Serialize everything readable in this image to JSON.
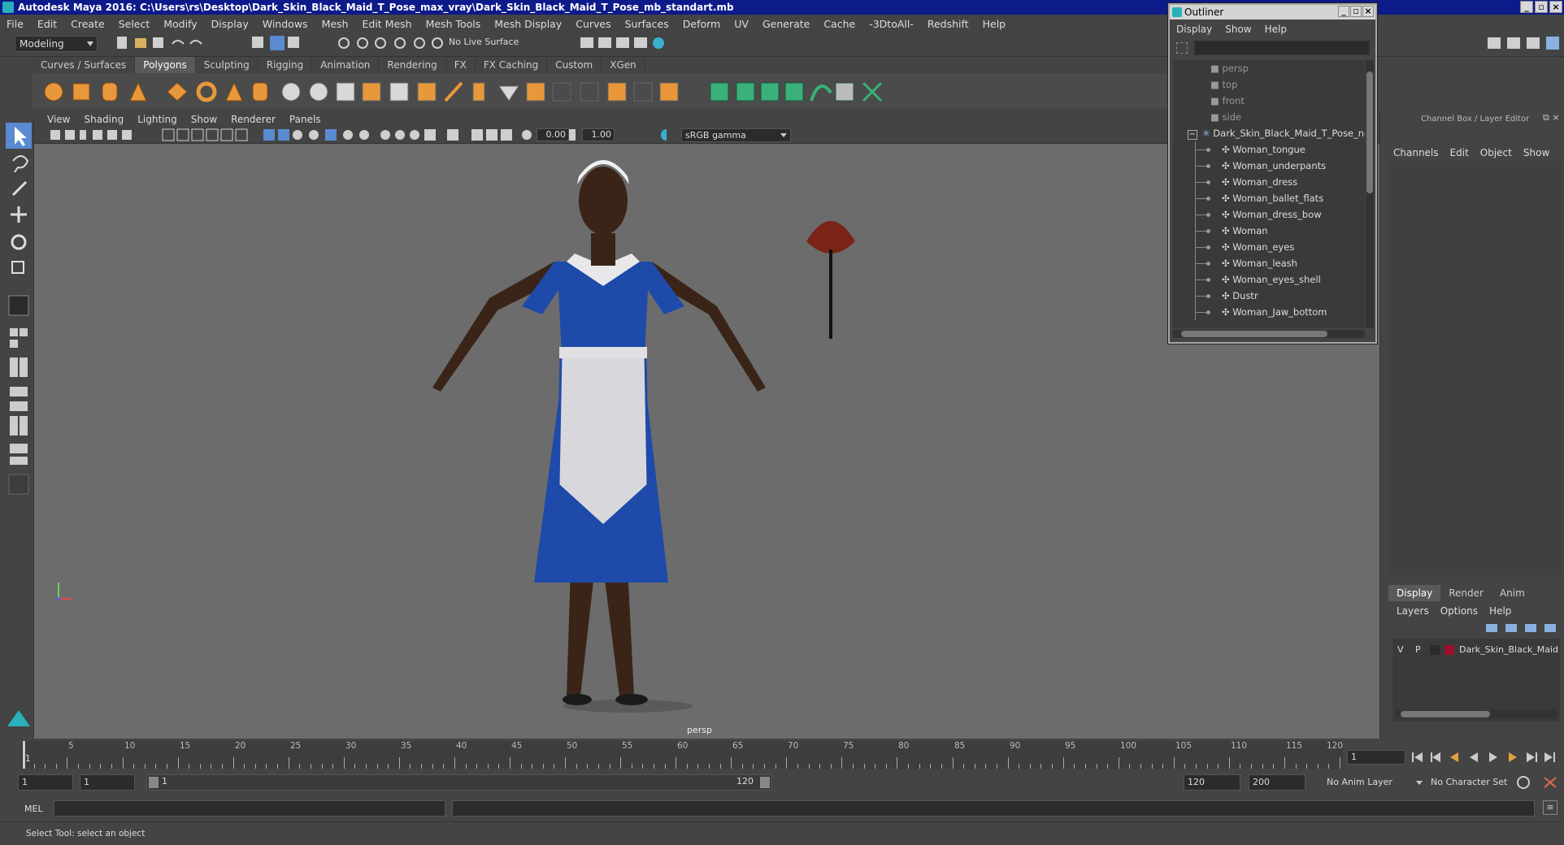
{
  "window": {
    "title": "Autodesk Maya 2016: C:\\Users\\rs\\Desktop\\Dark_Skin_Black_Maid_T_Pose_max_vray\\Dark_Skin_Black_Maid_T_Pose_mb_standart.mb"
  },
  "menubar": [
    "File",
    "Edit",
    "Create",
    "Select",
    "Modify",
    "Display",
    "Windows",
    "Mesh",
    "Edit Mesh",
    "Mesh Tools",
    "Mesh Display",
    "Curves",
    "Surfaces",
    "Deform",
    "UV",
    "Generate",
    "Cache",
    "-3DtoAll-",
    "Redshift",
    "Help"
  ],
  "toolbar": {
    "mode": "Modeling",
    "live_surface": "No Live Surface"
  },
  "shelf_tabs": [
    "Curves / Surfaces",
    "Polygons",
    "Sculpting",
    "Rigging",
    "Animation",
    "Rendering",
    "FX",
    "FX Caching",
    "Custom",
    "XGen"
  ],
  "shelf_active": "Polygons",
  "viewport": {
    "menu": [
      "View",
      "Shading",
      "Lighting",
      "Show",
      "Renderer",
      "Panels"
    ],
    "exposure": "0.00",
    "gamma": "1.00",
    "color_space": "sRGB gamma",
    "camera_label": "persp"
  },
  "outliner": {
    "title": "Outliner",
    "menu": [
      "Display",
      "Show",
      "Help"
    ],
    "cameras": [
      "persp",
      "top",
      "front",
      "side"
    ],
    "root": "Dark_Skin_Black_Maid_T_Pose_nc",
    "children": [
      "Woman_tongue",
      "Woman_underpants",
      "Woman_dress",
      "Woman_ballet_flats",
      "Woman_dress_bow",
      "Woman",
      "Woman_eyes",
      "Woman_leash",
      "Woman_eyes_shell",
      "Dustr",
      "Woman_Jaw_bottom"
    ]
  },
  "channelbox": {
    "header": "Channel Box / Layer Editor",
    "menu": [
      "Channels",
      "Edit",
      "Object",
      "Show"
    ],
    "layer_tabs": [
      "Display",
      "Render",
      "Anim"
    ],
    "layer_tab_active": "Display",
    "layer_menu": [
      "Layers",
      "Options",
      "Help"
    ],
    "layer": {
      "v": "V",
      "p": "P",
      "name": "Dark_Skin_Black_Maid",
      "color": "#9a1030"
    }
  },
  "timeline": {
    "ticks": [
      "5",
      "10",
      "15",
      "20",
      "25",
      "30",
      "35",
      "40",
      "45",
      "50",
      "55",
      "60",
      "65",
      "70",
      "75",
      "80",
      "85",
      "90",
      "95",
      "100",
      "105",
      "110",
      "115",
      "120"
    ],
    "start_label": "1",
    "current_frame": "1"
  },
  "range": {
    "start": "1",
    "inner_start": "1",
    "slider_start": "1",
    "slider_end": "120",
    "end": "120",
    "max": "200",
    "anim_layer": "No Anim Layer",
    "char_set": "No Character Set"
  },
  "command": {
    "lang": "MEL"
  },
  "status": {
    "text": "Select Tool: select an object"
  }
}
